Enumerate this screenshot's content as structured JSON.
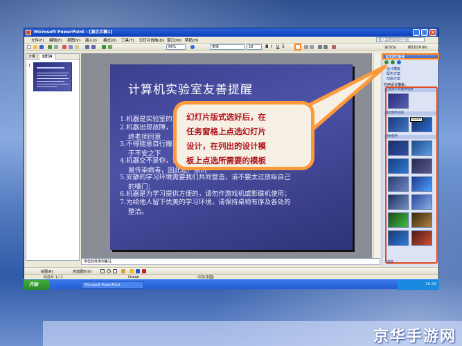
{
  "window": {
    "title": "Microsoft PowerPoint - [演示文稿1]",
    "help_placeholder": "键入需要帮助的问题",
    "controls": {
      "minimize": "_",
      "maximize": "□",
      "close": "×"
    }
  },
  "menu": [
    "文件(F)",
    "编辑(E)",
    "视图(V)",
    "插入(I)",
    "格式(O)",
    "工具(T)",
    "幻灯片放映(D)",
    "窗口(W)",
    "帮助(H)"
  ],
  "toolbar": {
    "zoom": "66%",
    "font": "宋体",
    "font_size": "18",
    "design_label": "设计(S)",
    "new_slide_label": "新幻灯片(N)"
  },
  "outline_tabs": [
    "大纲",
    "幻灯片"
  ],
  "slide": {
    "title": "计算机实验室友善提醒",
    "lines": [
      "1.机器是实验室的宝贵财产，",
      "2.机器出现故障，请及时告诉管理员，在末",
      "终老师同意",
      "3.不得随意自行搬动设备，不能私自将机器置",
      "于不安之下",
      "4.机器交不是你，请勿随意更改设置；上机容",
      "易传染病毒，因此是严禁的",
      "5.安静的学习环境需要我们共同营造，请不要太过放纵自己",
      "的嗓门；",
      "6.机器是为学习提供方便的，请勿作游戏机或影碟机使用；",
      "7.为给他人留下优美的学习环境，请保持桌椅有序及各处的",
      "整洁。"
    ]
  },
  "notes_placeholder": "单击此处添加备注",
  "drawbar": {
    "draw_label": "绘图(R)",
    "autoshape_label": "自选图形(U)"
  },
  "status": {
    "slide_count": "幻灯片 1 / 1",
    "design": "Ocean",
    "language": "中文(中国)"
  },
  "taskpane": {
    "title": "幻灯片设计",
    "links": [
      "设计模板",
      "配色方案",
      "动画方案"
    ],
    "apply_label": "应用设计模板：",
    "section_current": "在此演示文稿中使用",
    "section_recent": "最近使用过的",
    "section_available": "可供使用",
    "template_tooltip": "Ocean",
    "browse_label": "浏览..."
  },
  "callout": {
    "lines": [
      "幻灯片版式选好后，在",
      "任务窗格上点选幻灯片",
      "设计，在列出的设计模",
      "板上点选所需要的模板"
    ]
  },
  "taskbar": {
    "start": "开始",
    "items": [
      "Microsoft PowerPoint"
    ],
    "clock": "10:33"
  },
  "watermark": "京华手游网"
}
